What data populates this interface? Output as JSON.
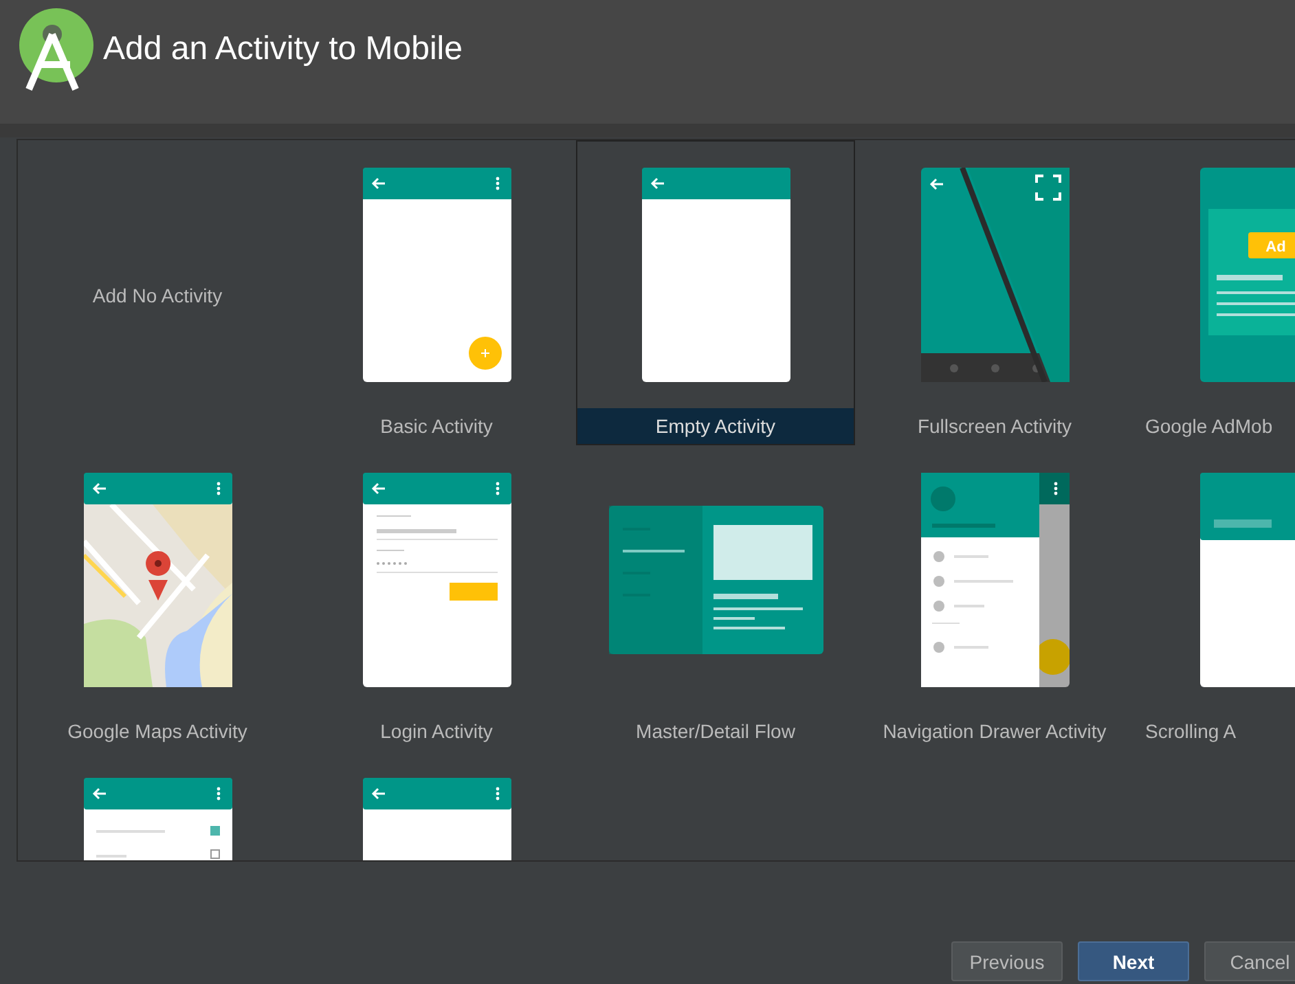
{
  "window": {
    "title": "Add an Activity to Mobile"
  },
  "templates": [
    {
      "kind": "none",
      "label": "Add No Activity",
      "selected": false
    },
    {
      "kind": "basic",
      "label": "Basic Activity",
      "selected": false
    },
    {
      "kind": "empty",
      "label": "Empty Activity",
      "selected": true
    },
    {
      "kind": "fullscreen",
      "label": "Fullscreen Activity",
      "selected": false
    },
    {
      "kind": "admob",
      "label": "Google AdMob",
      "badge": "Ad",
      "selected": false
    },
    {
      "kind": "maps",
      "label": "Google Maps Activity",
      "selected": false
    },
    {
      "kind": "login",
      "label": "Login Activity",
      "selected": false
    },
    {
      "kind": "master_detail",
      "label": "Master/Detail Flow",
      "selected": false
    },
    {
      "kind": "nav_drawer",
      "label": "Navigation Drawer Activity",
      "selected": false
    },
    {
      "kind": "scrolling",
      "label": "Scrolling A",
      "selected": false
    },
    {
      "kind": "settings",
      "selected": false
    },
    {
      "kind": "tabbed",
      "selected": false
    }
  ],
  "buttons": [
    {
      "label": "Previous",
      "kind": "secondary"
    },
    {
      "label": "Next",
      "kind": "primary"
    },
    {
      "label": "Cancel",
      "kind": "secondary"
    }
  ]
}
